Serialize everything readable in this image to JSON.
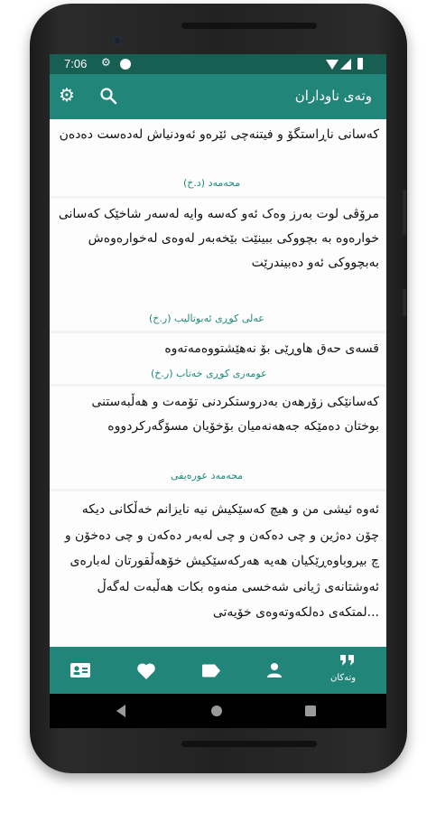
{
  "status_bar": {
    "time": "7:06"
  },
  "app_bar": {
    "title": "وتەی ناوداران"
  },
  "quotes": [
    {
      "text": "کەسانی ناڕاستگۆ و فیتنەچی  ئێرەو ئەودنیاش لەدەست دەدەن",
      "author": "محەمەد (د.خ)"
    },
    {
      "text": "مرۆڤی لوت بەرز وەک ئەو کەسە وایە لەسەر شاخێک کەسانی خوارەوە بە بچووکی ببینێت بێخەبەر لەوەی لەخوارەوەش بەبچووکی ئەو دەبیندرێت",
      "author": "عەلی کوڕی ئەبوتالیب (ر.خ)"
    },
    {
      "text": "قسەی حەق هاوڕێی بۆ نەهێشتووەمەتەوە",
      "author": "عومەری کوڕی خەتاب (ر.خ)"
    },
    {
      "text": "کەسانێکی زۆرهەن بەدروستکردنی تۆمەت و هەڵبەستنی بوختان دەمێکە جەهەنەمیان بۆخۆیان مسۆگەرکردووە",
      "author": "محەمەد عورەیفی"
    },
    {
      "text": "ئەوە ئیشی من و هیچ کەسێکیش نیە  نایزانم خەڵکانی دیکە چۆن دەژین و چی دەکەن و چی لەبەر دەکەن و چی دەخۆن و چ بیروباوەڕێکیان هەیە  هەرکەسێکیش خۆهەڵقورتان لەبارەی ئەوشتانەی ژیانی شەخسی منەوە بکات هەڵبەت لەگەڵ ...لمتکەی دەلکەوتەوەی خۆیەتی",
      "author": ""
    }
  ],
  "bottom_nav": {
    "items": [
      {
        "icon": "contacts-icon",
        "label": ""
      },
      {
        "icon": "heart-icon",
        "label": ""
      },
      {
        "icon": "tag-icon",
        "label": ""
      },
      {
        "icon": "person-icon",
        "label": ""
      },
      {
        "icon": "quote-icon",
        "label": "وتەکان"
      }
    ]
  },
  "colors": {
    "primary": "#22857a",
    "primary_dark": "#175f53",
    "author_text": "#1f8a79",
    "card_bg": "#fdfdfd",
    "divider": "#f2f2f2"
  }
}
